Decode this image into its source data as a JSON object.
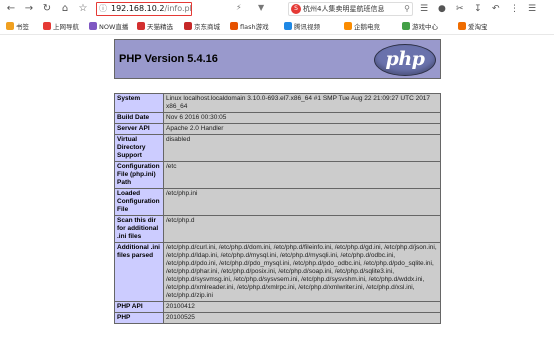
{
  "browser": {
    "address": {
      "host": "192.168.10.2",
      "path": "/info.php"
    },
    "news_text": "杭州4人集卖明星航班信息",
    "bookmarks": [
      {
        "label": "书签",
        "color": "#f0a020",
        "icon": "star-icon"
      },
      {
        "label": "上网导航",
        "color": "#e53935",
        "icon": "nav-icon"
      },
      {
        "label": "NOW直播",
        "color": "#7e57c2",
        "icon": "live-icon"
      },
      {
        "label": "天猫精选",
        "color": "#d32f2f",
        "icon": "tmall-icon"
      },
      {
        "label": "京东商城",
        "color": "#c62828",
        "icon": "jd-icon"
      },
      {
        "label": "flash游戏",
        "color": "#e65100",
        "icon": "flash-icon"
      },
      {
        "label": "腾讯视频",
        "color": "#1e88e5",
        "icon": "video-icon"
      },
      {
        "label": "企鹅电竞",
        "color": "#fb8c00",
        "icon": "esports-icon"
      },
      {
        "label": "游戏中心",
        "color": "#43a047",
        "icon": "game-icon"
      },
      {
        "label": "爱淘宝",
        "color": "#ef6c00",
        "icon": "taobao-icon"
      }
    ]
  },
  "page": {
    "title": "PHP Version 5.4.16",
    "logo_text": "php",
    "rows": [
      {
        "key": "System",
        "value": "Linux localhost.localdomain 3.10.0-693.el7.x86_64 #1 SMP Tue Aug 22 21:09:27 UTC 2017 x86_64"
      },
      {
        "key": "Build Date",
        "value": "Nov 6 2016 00:30:05"
      },
      {
        "key": "Server API",
        "value": "Apache 2.0 Handler"
      },
      {
        "key": "Virtual Directory Support",
        "value": "disabled"
      },
      {
        "key": "Configuration File (php.ini) Path",
        "value": "/etc"
      },
      {
        "key": "Loaded Configuration File",
        "value": "/etc/php.ini"
      },
      {
        "key": "Scan this dir for additional .ini files",
        "value": "/etc/php.d"
      },
      {
        "key": "Additional .ini files parsed",
        "value": "/etc/php.d/curl.ini, /etc/php.d/dom.ini, /etc/php.d/fileinfo.ini, /etc/php.d/gd.ini, /etc/php.d/json.ini, /etc/php.d/ldap.ini, /etc/php.d/mysql.ini, /etc/php.d/mysqli.ini, /etc/php.d/odbc.ini, /etc/php.d/pdo.ini, /etc/php.d/pdo_mysql.ini, /etc/php.d/pdo_odbc.ini, /etc/php.d/pdo_sqlite.ini, /etc/php.d/phar.ini, /etc/php.d/posix.ini, /etc/php.d/soap.ini, /etc/php.d/sqlite3.ini, /etc/php.d/sysvmsg.ini, /etc/php.d/sysvsem.ini, /etc/php.d/sysvshm.ini, /etc/php.d/wddx.ini, /etc/php.d/xmlreader.ini, /etc/php.d/xmlrpc.ini, /etc/php.d/xmlwriter.ini, /etc/php.d/xsl.ini, /etc/php.d/zip.ini"
      },
      {
        "key": "PHP API",
        "value": "20100412"
      },
      {
        "key": "PHP",
        "value": "20100525"
      }
    ]
  }
}
